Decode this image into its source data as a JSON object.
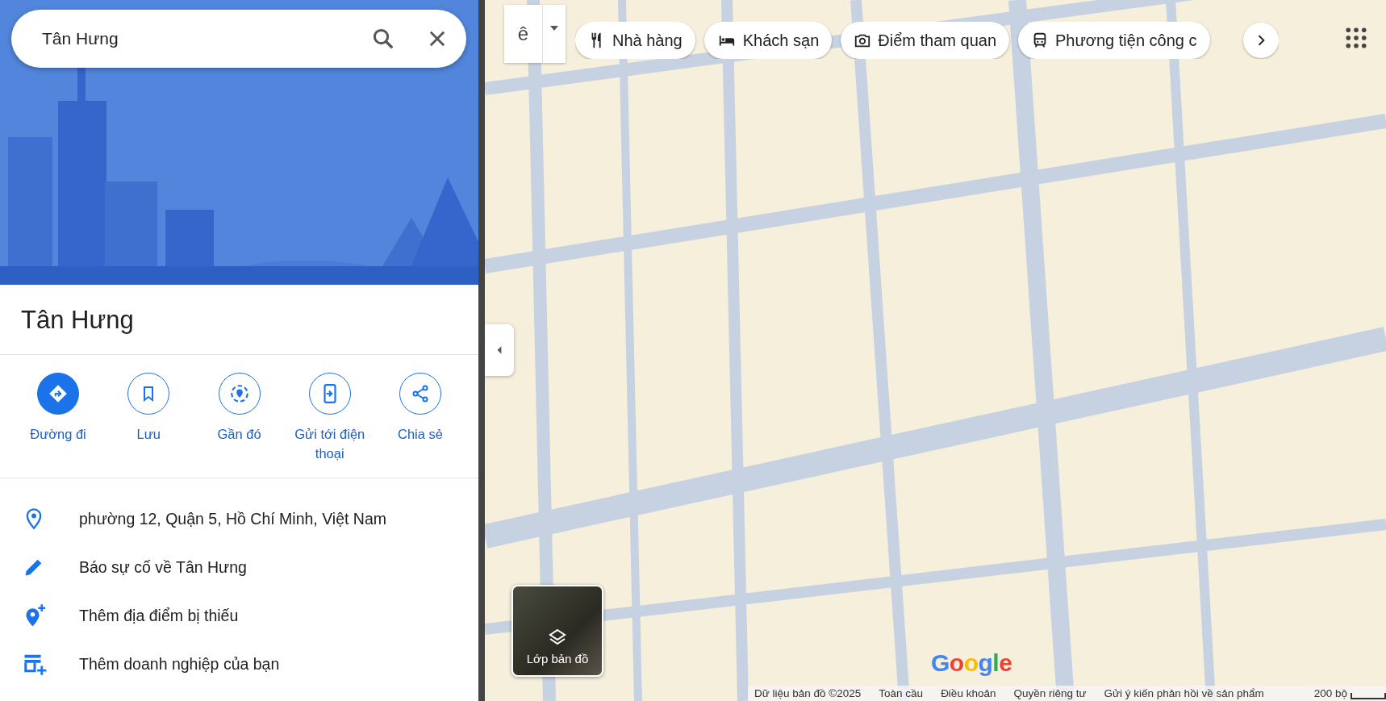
{
  "search": {
    "value": "Tân Hưng"
  },
  "place": {
    "title": "Tân Hưng"
  },
  "actions": [
    {
      "kind": "directions",
      "label": "Đường đi",
      "primary": true
    },
    {
      "kind": "save",
      "label": "Lưu",
      "primary": false
    },
    {
      "kind": "nearby",
      "label": "Gần đó",
      "primary": false
    },
    {
      "kind": "send",
      "label": "Gửi tới điện thoại",
      "primary": false
    },
    {
      "kind": "share",
      "label": "Chia sẻ",
      "primary": false
    }
  ],
  "info_rows": [
    {
      "kind": "address",
      "text": "phường 12, Quận 5, Hồ Chí Minh, Việt Nam"
    },
    {
      "kind": "report",
      "text": "Báo sự cố về Tân Hưng"
    },
    {
      "kind": "add-place",
      "text": "Thêm địa điểm bị thiếu"
    },
    {
      "kind": "add-business",
      "text": "Thêm doanh nghiệp của bạn"
    }
  ],
  "map": {
    "input_tool": "ê",
    "chips": [
      {
        "kind": "restaurant",
        "label": "Nhà hàng"
      },
      {
        "kind": "hotel",
        "label": "Khách sạn"
      },
      {
        "kind": "attraction",
        "label": "Điểm tham quan"
      },
      {
        "kind": "transit",
        "label": "Phương tiện công c"
      }
    ],
    "layers_label": "Lớp bản đồ",
    "logo": "Google",
    "footer": [
      "Dữ liệu bản đồ ©2025",
      "Toàn cầu",
      "Điều khoản",
      "Quyền riêng tư",
      "Gửi ý kiến phản hồi về sản phẩm"
    ],
    "scale": "200 bộ"
  }
}
